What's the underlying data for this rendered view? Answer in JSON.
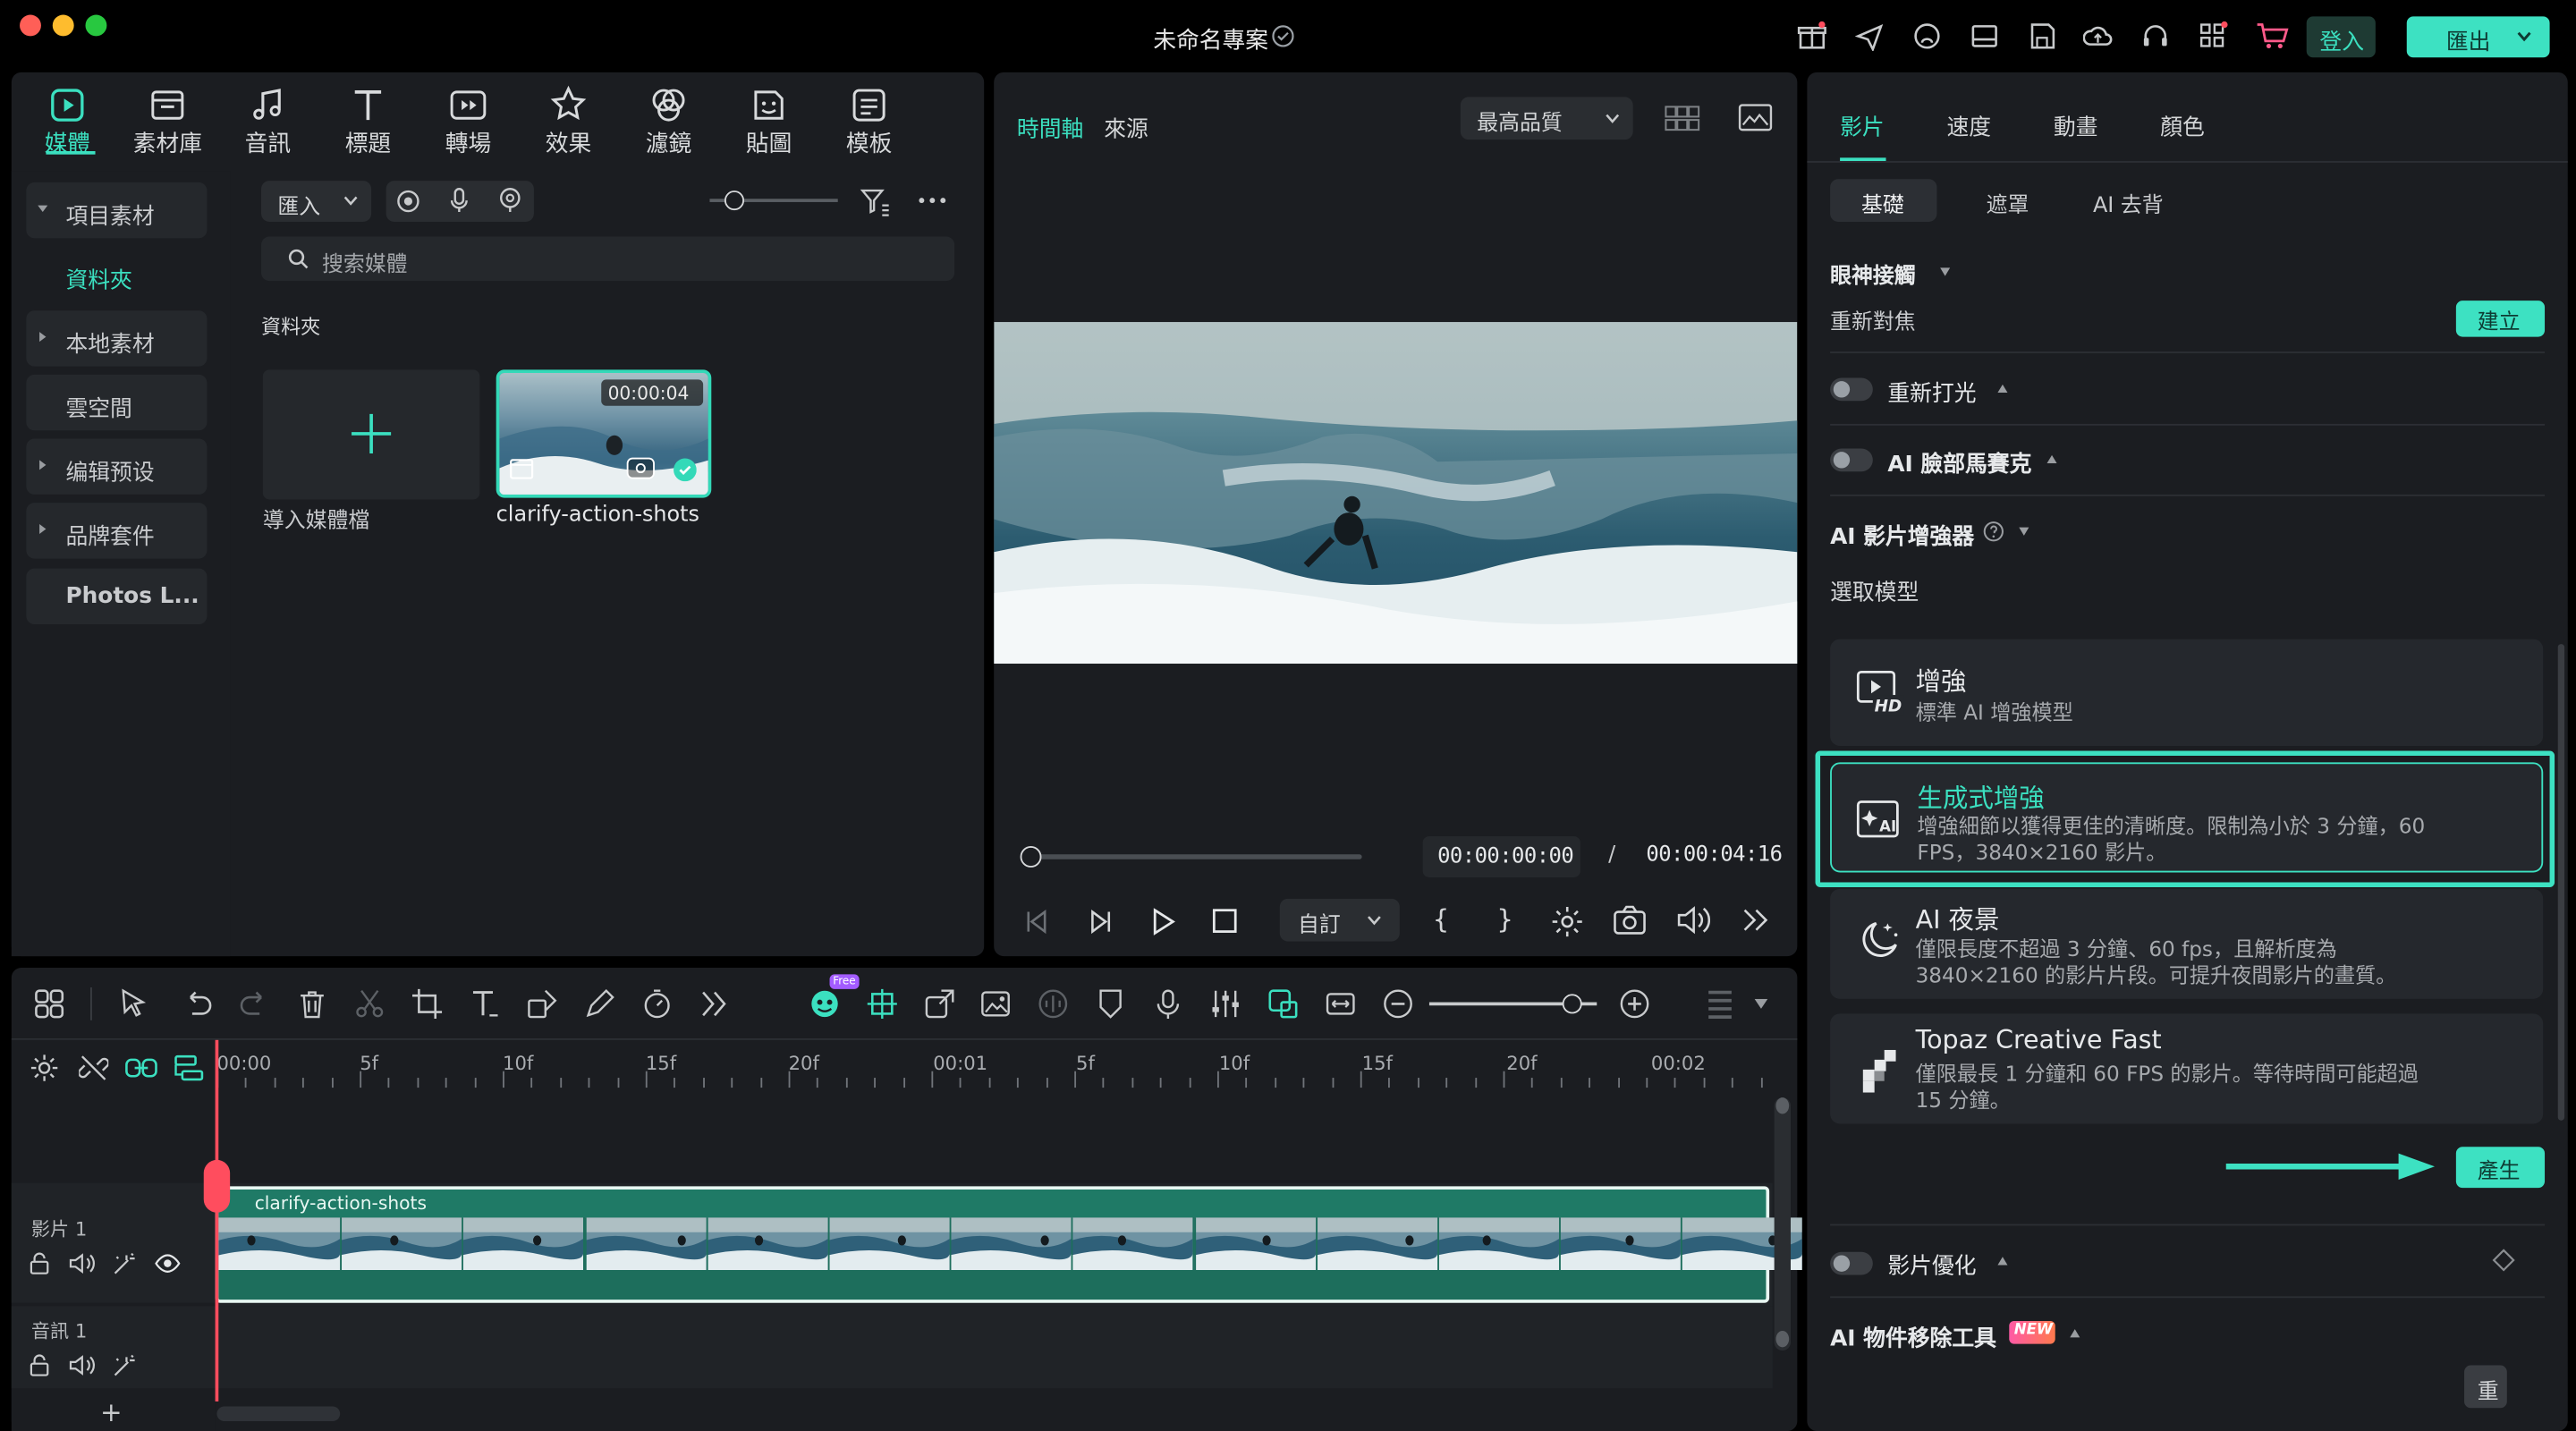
{
  "titlebar": {
    "title": "未命名專案",
    "login_label": "登入",
    "export_label": "匯出"
  },
  "toolbar": {
    "items": [
      {
        "label": "媒體",
        "icon": "media-icon",
        "active": true
      },
      {
        "label": "素材庫",
        "icon": "stock-library-icon"
      },
      {
        "label": "音訊",
        "icon": "music-note-icon"
      },
      {
        "label": "標題",
        "icon": "title-text-icon"
      },
      {
        "label": "轉場",
        "icon": "transition-icon"
      },
      {
        "label": "效果",
        "icon": "effects-star-icon"
      },
      {
        "label": "濾鏡",
        "icon": "filter-icon"
      },
      {
        "label": "貼圖",
        "icon": "sticker-icon"
      },
      {
        "label": "模板",
        "icon": "template-icon"
      }
    ]
  },
  "sidebar": {
    "items": [
      {
        "label": "項目素材",
        "expanded": true
      },
      {
        "label": "資料夾",
        "active": true
      },
      {
        "label": "本地素材"
      },
      {
        "label": "雲空間"
      },
      {
        "label": "编辑预设"
      },
      {
        "label": "品牌套件"
      },
      {
        "label": "Photos L..."
      }
    ]
  },
  "media": {
    "import_label": "匯入",
    "search_placeholder": "搜索媒體",
    "folder_label": "資料夾",
    "import_tile_label": "導入媒體檔",
    "clip": {
      "name": "clarify-action-shots",
      "duration": "00:00:04"
    }
  },
  "player": {
    "tab_timeline": "時間軸",
    "tab_source": "來源",
    "quality": "最高品質",
    "current_time": "00:00:00:00",
    "separator": "/",
    "total_time": "00:00:04:16",
    "zoom_select": "自訂",
    "bracket_in": "{",
    "bracket_out": "}"
  },
  "timeline": {
    "ai_badge": "Free",
    "ruler": [
      "00:00",
      "5f",
      "10f",
      "15f",
      "20f",
      "00:01",
      "5f",
      "10f",
      "15f",
      "20f",
      "00:02"
    ],
    "video_track": "影片 1",
    "audio_track": "音訊 1",
    "clip_name": "clarify-action-shots",
    "add_label": "+"
  },
  "right_panel": {
    "tabs": [
      "影片",
      "速度",
      "動畫",
      "顏色"
    ],
    "subtabs": [
      "基礎",
      "遮罩",
      "AI 去背"
    ],
    "eye_contact": "眼神接觸",
    "refocus": "重新對焦",
    "create_label": "建立",
    "relight": "重新打光",
    "face_mosaic": "AI 臉部馬賽克",
    "enhancer_title": "AI 影片增強器",
    "choose_model": "選取模型",
    "models": [
      {
        "title": "增強",
        "desc": "標準 AI 增強模型"
      },
      {
        "title": "生成式增強",
        "desc": "增強細節以獲得更佳的清晰度。限制為小於 3 分鐘，60 FPS，3840×2160 影片。",
        "selected": true
      },
      {
        "title": "AI 夜景",
        "desc": "僅限長度不超過 3 分鐘、60 fps，且解析度為 3840×2160 的影片片段。可提升夜間影片的畫質。"
      },
      {
        "title": "Topaz Creative Fast",
        "desc": "僅限最長 1 分鐘和 60 FPS 的影片。等待時間可能超過 15 分鐘。"
      }
    ],
    "generate_label": "產生",
    "optimize": "影片優化",
    "object_remove": "AI 物件移除工具",
    "new_badge": "NEW",
    "reset_label": "重"
  },
  "colors": {
    "accent": "#3be0c0",
    "selection": "#33d9b8",
    "panel": "#1b1d21",
    "playhead": "#ff4d5e"
  }
}
